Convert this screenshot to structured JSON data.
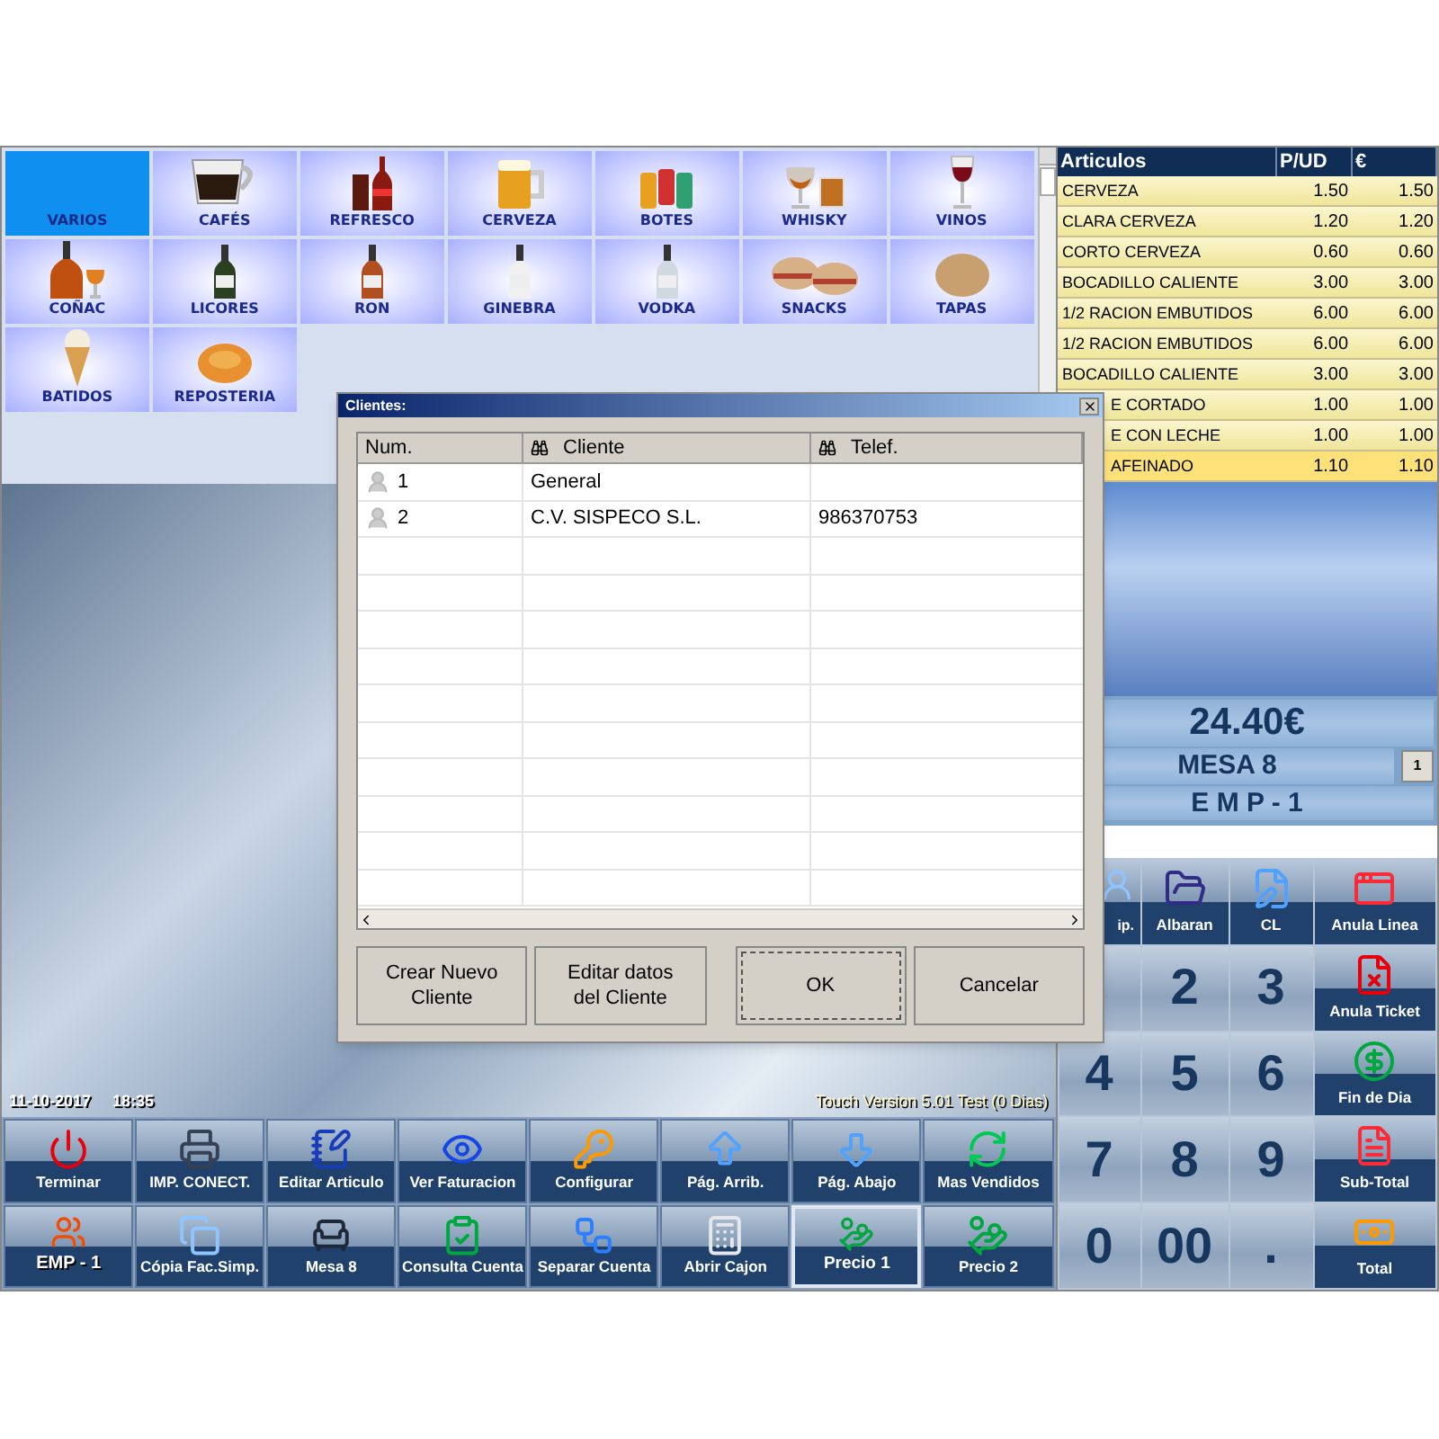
{
  "categories": [
    {
      "label": "VARIOS",
      "selected": true
    },
    {
      "label": "CAFÉS",
      "selected": false
    },
    {
      "label": "REFRESCO",
      "selected": false
    },
    {
      "label": "CERVEZA",
      "selected": false
    },
    {
      "label": "BOTES",
      "selected": false
    },
    {
      "label": "WHISKY",
      "selected": false
    },
    {
      "label": "VINOS",
      "selected": false
    },
    {
      "label": "COÑAC",
      "selected": false
    },
    {
      "label": "LICORES",
      "selected": false
    },
    {
      "label": "RON",
      "selected": false
    },
    {
      "label": "GINEBRA",
      "selected": false
    },
    {
      "label": "VODKA",
      "selected": false
    },
    {
      "label": "SNACKS",
      "selected": false
    },
    {
      "label": "TAPAS",
      "selected": false
    },
    {
      "label": "BATIDOS",
      "selected": false
    },
    {
      "label": "REPOSTERIA",
      "selected": false
    }
  ],
  "articles": {
    "columns": [
      "Articulos",
      "P/UD",
      "€"
    ],
    "rows": [
      {
        "kind": "full",
        "name": "CERVEZA",
        "price": "1.50",
        "amount": "1.50",
        "selected": false
      },
      {
        "kind": "full",
        "name": "CLARA CERVEZA",
        "price": "1.20",
        "amount": "1.20",
        "selected": false
      },
      {
        "kind": "full",
        "name": "CORTO CERVEZA",
        "price": "0.60",
        "amount": "0.60",
        "selected": false
      },
      {
        "kind": "full",
        "name": "BOCADILLO CALIENTE",
        "price": "3.00",
        "amount": "3.00",
        "selected": false
      },
      {
        "kind": "full",
        "name": "1/2 RACION EMBUTIDOS",
        "price": "6.00",
        "amount": "6.00",
        "selected": false
      },
      {
        "kind": "full",
        "name": "1/2 RACION EMBUTIDOS",
        "price": "6.00",
        "amount": "6.00",
        "selected": false
      },
      {
        "kind": "full",
        "name": "BOCADILLO CALIENTE",
        "price": "3.00",
        "amount": "3.00",
        "selected": false
      },
      {
        "kind": "partial",
        "name": "E CORTADO",
        "price": "1.00",
        "amount": "1.00",
        "selected": false
      },
      {
        "kind": "partial",
        "name": "E CON LECHE",
        "price": "1.00",
        "amount": "1.00",
        "selected": false
      },
      {
        "kind": "partial",
        "name": "AFEINADO",
        "price": "1.10",
        "amount": "1.10",
        "selected": true
      }
    ]
  },
  "summary": {
    "total": "24.40€",
    "table": "MESA 8",
    "employee": "E M P - 1",
    "counter": "1"
  },
  "keypad": [
    {
      "kind": "partial",
      "label": "ip."
    },
    {
      "kind": "function",
      "label": "Albaran"
    },
    {
      "kind": "function",
      "label": "CL"
    },
    {
      "kind": "function",
      "label": "Anula Linea"
    },
    {
      "kind": "digit"
    },
    {
      "kind": "digit",
      "label": "2"
    },
    {
      "kind": "digit",
      "label": "3"
    },
    {
      "kind": "function",
      "label": "Anula Ticket"
    },
    {
      "kind": "digit",
      "label": "4"
    },
    {
      "kind": "digit",
      "label": "5"
    },
    {
      "kind": "digit",
      "label": "6"
    },
    {
      "kind": "function",
      "label": "Fin de Dia"
    },
    {
      "kind": "digit",
      "label": "7"
    },
    {
      "kind": "digit",
      "label": "8"
    },
    {
      "kind": "digit",
      "label": "9"
    },
    {
      "kind": "function",
      "label": "Sub-Total"
    },
    {
      "kind": "digit",
      "label": "0"
    },
    {
      "kind": "digit",
      "label": "00"
    },
    {
      "kind": "digit",
      "label": "."
    },
    {
      "kind": "function",
      "label": "Total"
    }
  ],
  "status": {
    "date": "11-10-2017",
    "time": "18:35",
    "version": "Touch Version 5.01 Test (0 Dias)"
  },
  "toolbar": [
    {
      "kind": "button",
      "label": "Terminar",
      "selected": false
    },
    {
      "kind": "button",
      "label": "IMP. CONECT.",
      "selected": false
    },
    {
      "kind": "button",
      "label": "Editar Articulo",
      "selected": false
    },
    {
      "kind": "button",
      "label": "Ver Faturacion",
      "selected": false
    },
    {
      "kind": "button",
      "label": "Configurar",
      "selected": false
    },
    {
      "kind": "button",
      "label": "Pág. Arrib.",
      "selected": false
    },
    {
      "kind": "button",
      "label": "Pág. Abajo",
      "selected": false
    },
    {
      "kind": "button",
      "label": "Mas Vendidos",
      "selected": false
    },
    {
      "kind": "overlay",
      "label": "EMP - 1",
      "selected": false
    },
    {
      "kind": "button",
      "label": "Cópia Fac.Simp.",
      "selected": false
    },
    {
      "kind": "button",
      "label": "Mesa 8",
      "selected": false
    },
    {
      "kind": "button",
      "label": "Consulta Cuenta",
      "selected": false
    },
    {
      "kind": "button",
      "label": "Separar Cuenta",
      "selected": false
    },
    {
      "kind": "button",
      "label": "Abrir Cajon",
      "selected": false
    },
    {
      "kind": "button",
      "label": "Precio 1",
      "selected": true
    },
    {
      "kind": "button",
      "label": "Precio 2",
      "selected": false
    }
  ],
  "dialog": {
    "title": "Clientes:",
    "columns": [
      "Num.",
      "Cliente",
      "Telef."
    ],
    "rows": [
      {
        "num": "1",
        "name": "General"
      },
      {
        "num": "2",
        "name": "C.V. SISPECO S.L.",
        "phone": "986370753"
      }
    ],
    "buttons": [
      {
        "label": "Crear Nuevo Cliente",
        "focused": false
      },
      {
        "label": "Editar datos del Cliente",
        "focused": false
      },
      {
        "label": "OK",
        "focused": true
      },
      {
        "label": "Cancelar",
        "focused": false
      }
    ]
  }
}
